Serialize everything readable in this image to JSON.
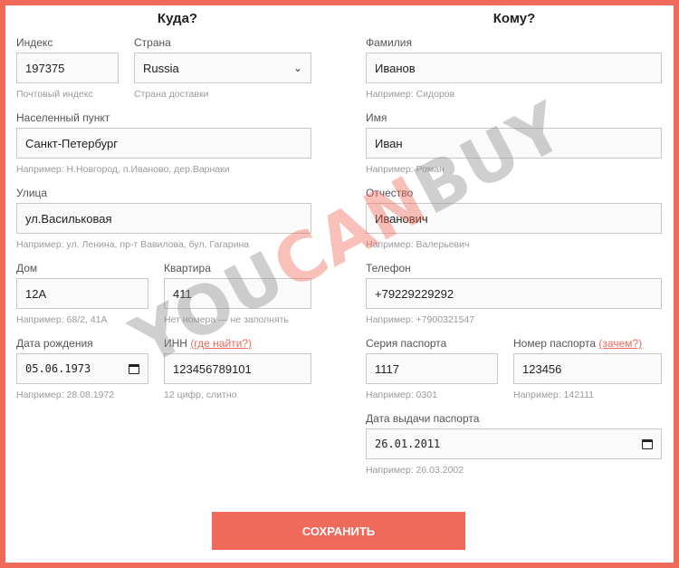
{
  "colors": {
    "accent": "#ef6a5b",
    "frame": "#ef6a5b"
  },
  "left": {
    "heading": "Куда?",
    "index": {
      "label": "Индекс",
      "value": "197375",
      "hint": "Почтовый индекс"
    },
    "country": {
      "label": "Страна",
      "value": "Russia",
      "hint": "Страна доставки"
    },
    "city": {
      "label": "Населенный пункт",
      "value": "Санкт-Петербург",
      "hint": "Например: Н.Новгород, п.Иваново, дер.Варнаки"
    },
    "street": {
      "label": "Улица",
      "value": "ул.Васильковая",
      "hint": "Например: ул. Ленина, пр-т Вавилова, бул. Гагарина"
    },
    "house": {
      "label": "Дом",
      "value": "12А",
      "hint": "Например: 68/2, 41А"
    },
    "apartment": {
      "label": "Квартира",
      "value": "411",
      "hint": "Нет номера — не заполнять"
    },
    "birth_date": {
      "label": "Дата рождения",
      "value": "05.06.1973",
      "hint": "Например: 28.08.1972"
    },
    "inn": {
      "label": "ИНН",
      "link": "(где найти?)",
      "value": "123456789101",
      "hint": "12 цифр, слитно"
    }
  },
  "right": {
    "heading": "Кому?",
    "surname": {
      "label": "Фамилия",
      "value": "Иванов",
      "hint": "Например: Сидоров"
    },
    "name": {
      "label": "Имя",
      "value": "Иван",
      "hint": "Например: Роман"
    },
    "patronymic": {
      "label": "Отчество",
      "value": "Иванович",
      "hint": "Например: Валерьевич"
    },
    "phone": {
      "label": "Телефон",
      "value": "+79229229292",
      "hint": "Например: +7900321547"
    },
    "passport_series": {
      "label": "Серия паспорта",
      "value": "1117",
      "hint": "Например: 0301"
    },
    "passport_number": {
      "label": "Номер паспорта",
      "link": "(зачем?)",
      "value": "123456",
      "hint": "Например: 142111"
    },
    "passport_date": {
      "label": "Дата выдачи паспорта",
      "value": "26.01.2011",
      "hint": "Например: 26.03.2002"
    }
  },
  "save_button": "СОХРАНИТЬ",
  "watermark": {
    "part1": "YOU",
    "part2": "CAN",
    "part3": "BUY",
    "color_gray": "#8f8f8f",
    "color_red": "#ef6a5b"
  }
}
